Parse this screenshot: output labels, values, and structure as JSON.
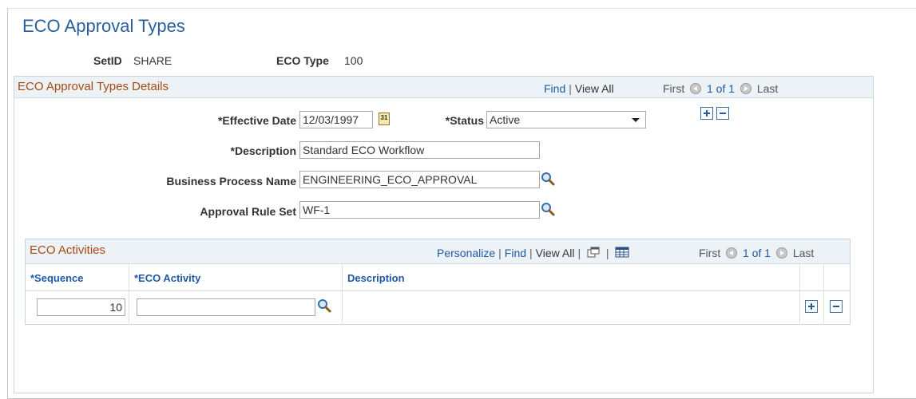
{
  "page": {
    "title": "ECO Approval Types"
  },
  "header": {
    "setid_label": "SetID",
    "setid_value": "SHARE",
    "eco_type_label": "ECO Type",
    "eco_type_value": "100"
  },
  "details": {
    "title": "ECO Approval Types Details",
    "nav": {
      "find": "Find",
      "sep": "|",
      "view_all": "View All",
      "first": "First",
      "range": "1 of 1",
      "last": "Last"
    },
    "effective_date": {
      "label": "*Effective Date",
      "value": "12/03/1997",
      "calendar_glyph": "31"
    },
    "status": {
      "label": "*Status",
      "value": "Active"
    },
    "description": {
      "label": "*Description",
      "value": "Standard ECO Workflow"
    },
    "business_process": {
      "label": "Business Process Name",
      "value": "ENGINEERING_ECO_APPROVAL"
    },
    "approval_rule_set": {
      "label": "Approval Rule Set",
      "value": "WF-1"
    }
  },
  "activities": {
    "title": "ECO Activities",
    "nav": {
      "personalize": "Personalize",
      "find": "Find",
      "view_all": "View All",
      "sep": "|",
      "first": "First",
      "range": "1 of 1",
      "last": "Last"
    },
    "columns": [
      "*Sequence",
      "*ECO Activity",
      "Description"
    ],
    "rows": [
      {
        "sequence": "10",
        "eco_activity": "",
        "description": ""
      }
    ]
  },
  "colors": {
    "title": "#2a5f9e",
    "link": "#1f5aa6",
    "section_title": "#a84a10",
    "header_bg": "#edf2f7"
  },
  "icons": [
    "lookup-icon",
    "calendar-icon",
    "add-row-icon",
    "delete-row-icon",
    "previous-icon",
    "next-icon",
    "new-window-icon",
    "download-grid-icon"
  ]
}
